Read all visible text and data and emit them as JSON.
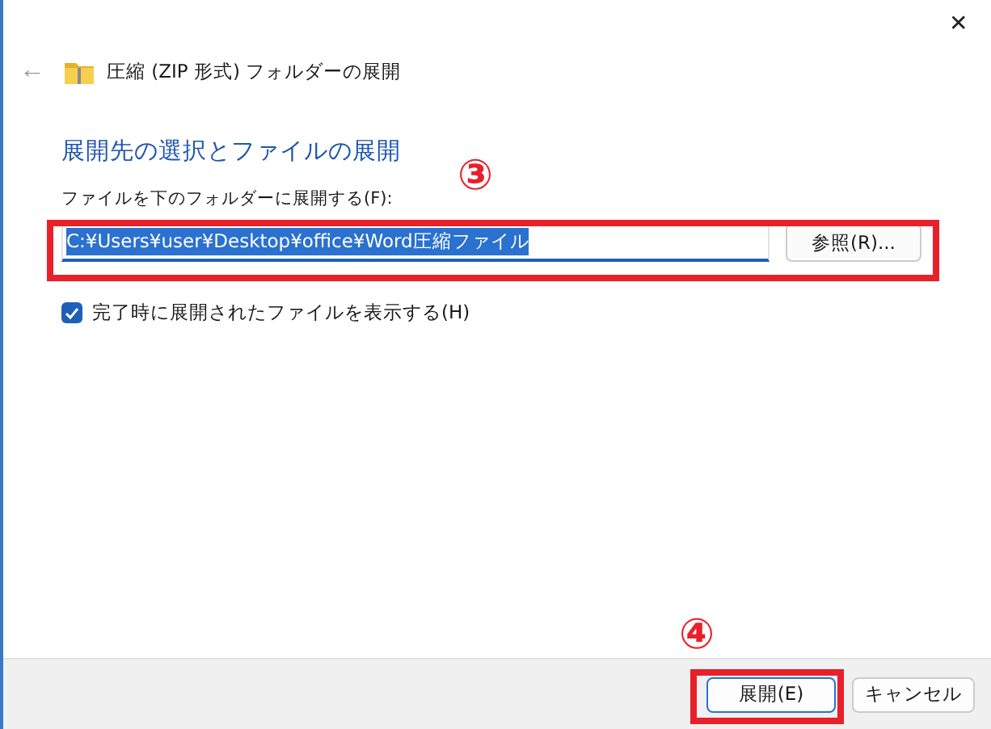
{
  "window": {
    "title": "圧縮 (ZIP 形式) フォルダーの展開",
    "close": "✕",
    "back": "←"
  },
  "heading": "展開先の選択とファイルの展開",
  "destination": {
    "label": "ファイルを下のフォルダーに展開する(F):",
    "value": "C:¥Users¥user¥Desktop¥office¥Word圧縮ファイル",
    "selected": true,
    "browse": "参照(R)..."
  },
  "show_files": {
    "label": "完了時に展開されたファイルを表示する(H)",
    "checked": true
  },
  "buttons": [
    {
      "label": "展開(E)",
      "kind": "primary"
    },
    {
      "label": "キャンセル",
      "kind": "secondary"
    }
  ],
  "annotations": [
    {
      "label": "③"
    },
    {
      "label": "④"
    }
  ]
}
